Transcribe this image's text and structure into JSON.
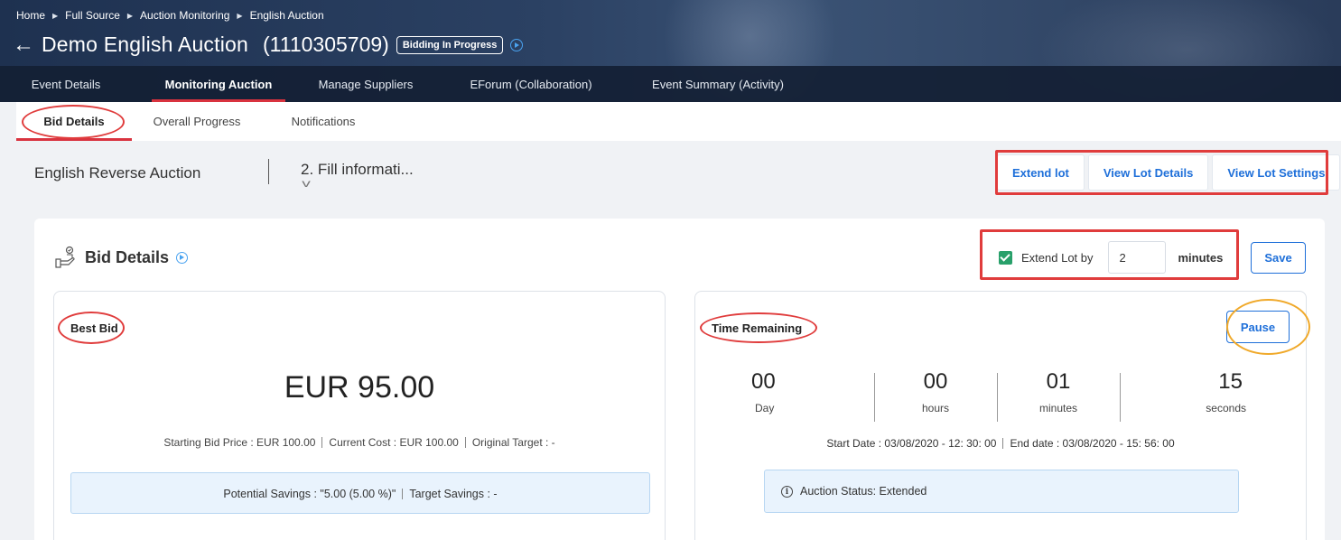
{
  "breadcrumb": [
    "Home",
    "Full Source",
    "Auction Monitoring",
    "English Auction"
  ],
  "header": {
    "title": "Demo English Auction",
    "event_id": "(1110305709)",
    "status": "Bidding In Progress"
  },
  "main_tabs": [
    {
      "label": "Event Details"
    },
    {
      "label": "Monitoring Auction",
      "active": true
    },
    {
      "label": "Manage Suppliers"
    },
    {
      "label": "EForum (Collaboration)"
    },
    {
      "label": "Event Summary (Activity)"
    }
  ],
  "sub_tabs": [
    {
      "label": "Bid Details",
      "active": true
    },
    {
      "label": "Overall Progress"
    },
    {
      "label": "Notifications"
    }
  ],
  "context": {
    "auction_type": "English Reverse Auction",
    "step": "2. Fill informati..."
  },
  "actions": {
    "extend_lot": "Extend lot",
    "view_lot_details": "View Lot Details",
    "view_lot_settings": "View Lot Settings"
  },
  "bid_details": {
    "title": "Bid Details",
    "extend_label": "Extend Lot by",
    "extend_checked": true,
    "extend_value": "2",
    "extend_unit": "minutes",
    "save": "Save"
  },
  "best_bid": {
    "title": "Best Bid",
    "price": "EUR 95.00",
    "starting_bid": "Starting Bid Price : EUR 100.00",
    "current_cost": "Current Cost : EUR 100.00",
    "original_target": "Original Target : -",
    "potential_savings": "Potential Savings : \"5.00 (5.00 %)\"",
    "target_savings": "Target Savings : -"
  },
  "time_remaining": {
    "title": "Time Remaining",
    "pause": "Pause",
    "units": [
      {
        "value": "00",
        "label": "Day"
      },
      {
        "value": "00",
        "label": "hours"
      },
      {
        "value": "01",
        "label": "minutes"
      },
      {
        "value": "15",
        "label": "seconds"
      }
    ],
    "start_date": "Start Date : 03/08/2020 - 12: 30: 00",
    "end_date": "End date : 03/08/2020 - 15: 56: 00",
    "auction_status": "Auction Status: Extended"
  },
  "colors": {
    "accent": "#1e6fd9",
    "active_tab": "#d9333f",
    "annotation_red": "#e03c3c",
    "annotation_orange": "#f0a92a",
    "checkbox": "#28a06a"
  }
}
